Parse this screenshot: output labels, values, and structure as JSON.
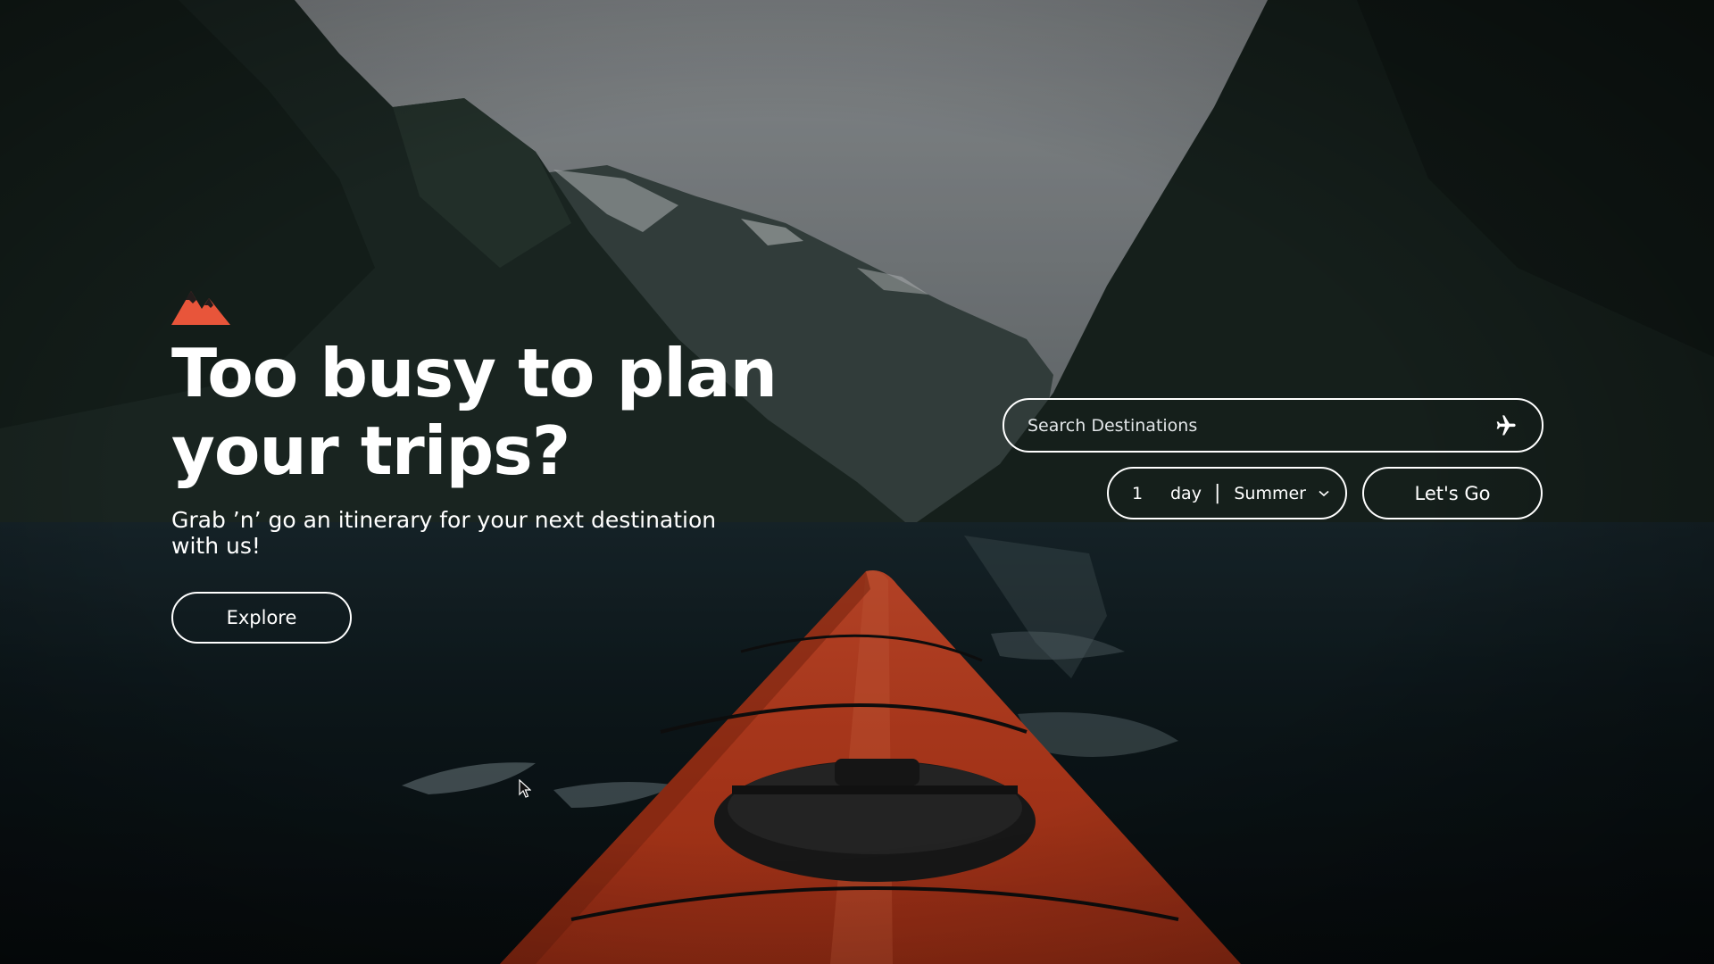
{
  "hero": {
    "logo_icon": "mountain-logo-icon",
    "accent_color": "#e8553a",
    "headline": "Too busy to plan your trips?",
    "subtext": "Grab ’n’ go an itinerary for your next destination with us!",
    "explore_label": "Explore"
  },
  "planner": {
    "search_placeholder": "Search Destinations",
    "search_value": "",
    "search_icon": "airplane-icon",
    "duration_value": "1",
    "duration_unit": "day",
    "separator": "|",
    "season_selected": "Summer",
    "season_icon": "chevron-down-icon",
    "go_label": "Let's Go"
  },
  "background": {
    "scene": "kayak-fjord-photo"
  }
}
